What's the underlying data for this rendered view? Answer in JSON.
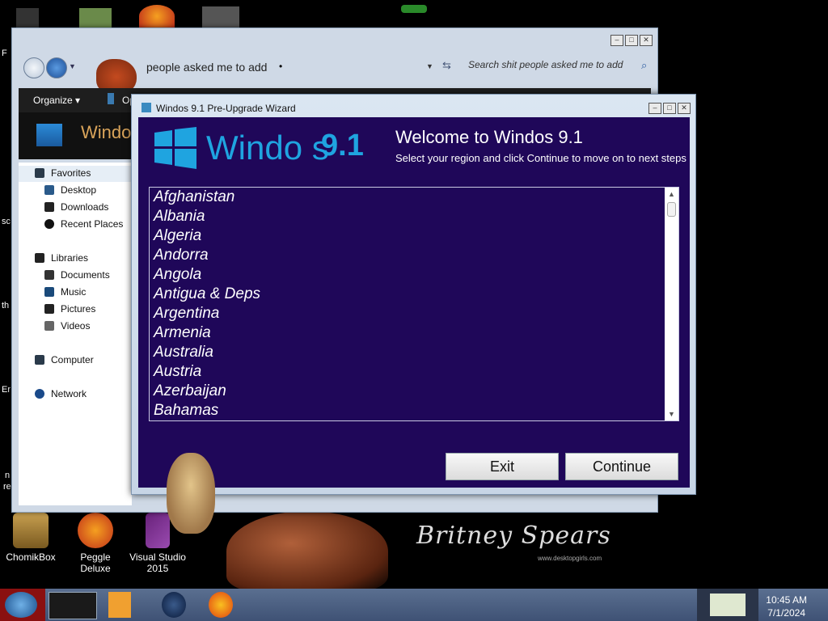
{
  "desktop": {
    "icons": [
      {
        "label": "ChomikBox",
        "label2": ""
      },
      {
        "label": "Peggle Deluxe",
        "label2": ""
      },
      {
        "label": "Visual Studio",
        "label2": "2015"
      }
    ],
    "wallpaper_signature": "Britney Spears",
    "wallpaper_url": "www.desktopgirls.com",
    "edge_text": [
      "F",
      "sc",
      "th",
      "Er",
      "n",
      "re"
    ]
  },
  "explorer": {
    "address": "people asked me to add",
    "search_placeholder": "Search shit people asked me to add",
    "toolbar_organize": "Organize",
    "toolbar_open": "Op",
    "header_title": "Windo",
    "nav": {
      "favorites": "Favorites",
      "desktop": "Desktop",
      "downloads": "Downloads",
      "recent": "Recent Places",
      "libraries": "Libraries",
      "documents": "Documents",
      "music": "Music",
      "pictures": "Pictures",
      "videos": "Videos",
      "computer": "Computer",
      "network": "Network"
    }
  },
  "wizard": {
    "title": "Windos 9.1 Pre-Upgrade Wizard",
    "logo_text": "Windo  s",
    "logo_version": "9.1",
    "welcome": "Welcome to Windos 9.1",
    "subtitle": "Select your region and click Continue to move on to next steps",
    "countries": [
      "Afghanistan",
      "Albania",
      "Algeria",
      "Andorra",
      "Angola",
      "Antigua & Deps",
      "Argentina",
      "Armenia",
      "Australia",
      "Austria",
      "Azerbaijan",
      "Bahamas"
    ],
    "exit_label": "Exit",
    "continue_label": "Continue"
  },
  "taskbar": {
    "time": "10:45 AM",
    "date": "7/1/2024"
  }
}
